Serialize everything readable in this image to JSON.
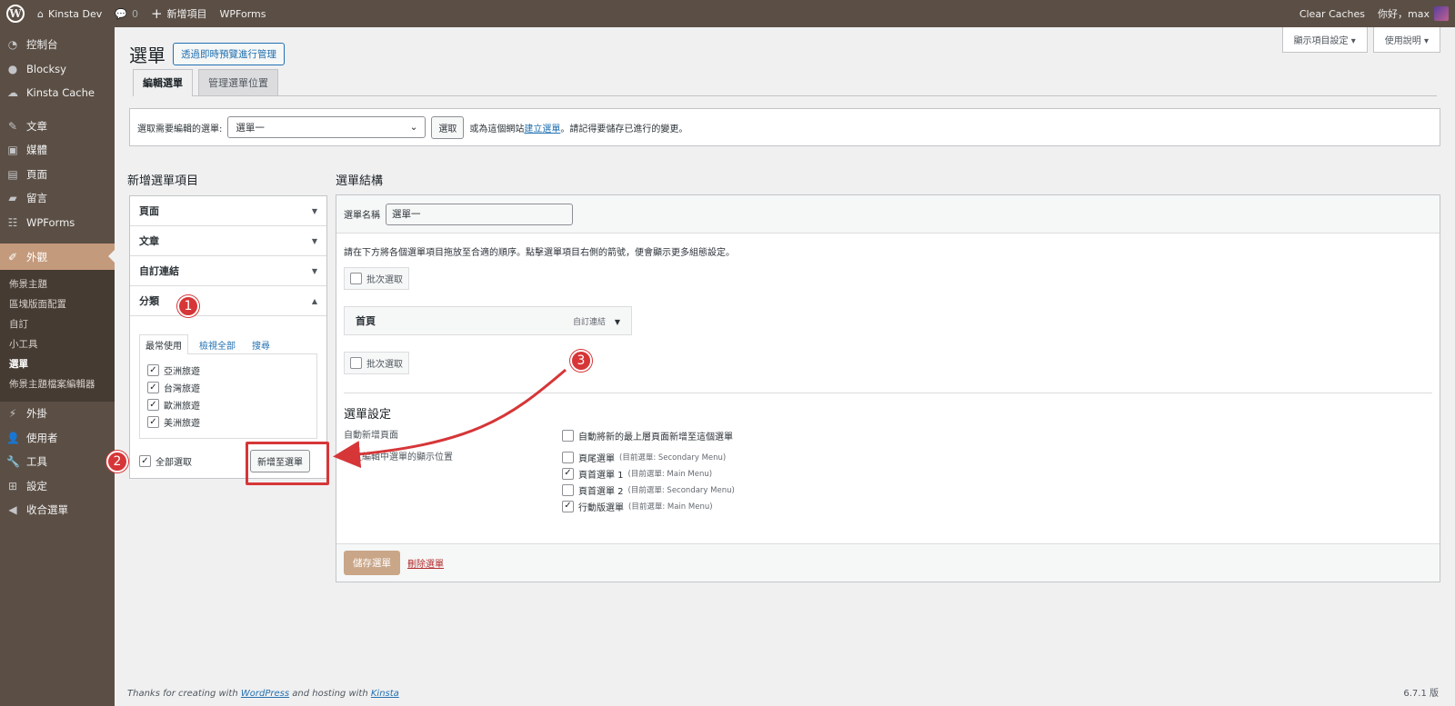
{
  "adminbar": {
    "site_name": "Kinsta Dev",
    "comments_count": "0",
    "new_label": "新增項目",
    "wpforms": "WPForms",
    "clear_caches": "Clear Caches",
    "greeting": "你好，max"
  },
  "sidebar": {
    "items": [
      {
        "label": "控制台",
        "icon": "dashboard-icon"
      },
      {
        "label": "Blocksy",
        "icon": "blocksy-icon"
      },
      {
        "label": "Kinsta Cache",
        "icon": "cloud-icon"
      },
      {
        "label": "文章",
        "icon": "pin-icon"
      },
      {
        "label": "媒體",
        "icon": "media-icon"
      },
      {
        "label": "頁面",
        "icon": "page-icon"
      },
      {
        "label": "留言",
        "icon": "comment-icon"
      },
      {
        "label": "WPForms",
        "icon": "forms-icon"
      },
      {
        "label": "外觀",
        "icon": "brush-icon"
      },
      {
        "label": "外掛",
        "icon": "plugin-icon"
      },
      {
        "label": "使用者",
        "icon": "user-icon"
      },
      {
        "label": "工具",
        "icon": "wrench-icon"
      },
      {
        "label": "設定",
        "icon": "settings-icon"
      },
      {
        "label": "收合選單",
        "icon": "collapse-icon"
      }
    ],
    "submenu": [
      "佈景主題",
      "區塊版面配置",
      "自訂",
      "小工具",
      "選單",
      "佈景主題檔案編輯器"
    ]
  },
  "header": {
    "screen_options": "顯示項目設定",
    "help": "使用說明",
    "title": "選單",
    "live_preview": "透過即時預覽進行管理",
    "tabs": [
      "編輯選單",
      "管理選單位置"
    ]
  },
  "select_bar": {
    "label": "選取需要編輯的選單:",
    "selected": "選單一",
    "select_btn": "選取",
    "or_text": "或為這個網站",
    "create_link": "建立選單",
    "remember": "。請記得要儲存已進行的變更。"
  },
  "add_items": {
    "title": "新增選單項目",
    "sections": [
      "頁面",
      "文章",
      "自訂連結",
      "分類"
    ],
    "subtabs": [
      "最常使用",
      "檢視全部",
      "搜尋"
    ],
    "categories": [
      {
        "label": "亞洲旅遊",
        "checked": true
      },
      {
        "label": "台灣旅遊",
        "checked": true
      },
      {
        "label": "歐洲旅遊",
        "checked": true
      },
      {
        "label": "美洲旅遊",
        "checked": true
      }
    ],
    "select_all": "全部選取",
    "add_button": "新增至選單"
  },
  "structure": {
    "title": "選單結構",
    "name_label": "選單名稱",
    "name_value": "選單一",
    "instructions": "請在下方將各個選單項目拖放至合適的順序。點擊選單項目右側的箭號，便會顯示更多組態設定。",
    "bulk_select": "批次選取",
    "menu_item": {
      "title": "首頁",
      "type": "自訂連結"
    },
    "settings_title": "選單設定",
    "auto_add_label": "自動新增頁面",
    "auto_add_option": "自動將新的最上層頁面新增至這個選單",
    "display_label": "指定編輯中選單的顯示位置",
    "locations": [
      {
        "label": "頁尾選單",
        "note": "(目前選單: Secondary Menu)",
        "checked": false
      },
      {
        "label": "頁首選單 1",
        "note": "(目前選單: Main Menu)",
        "checked": true
      },
      {
        "label": "頁首選單 2",
        "note": "(目前選單: Secondary Menu)",
        "checked": false
      },
      {
        "label": "行動版選單",
        "note": "(目前選單: Main Menu)",
        "checked": true
      }
    ],
    "save": "儲存選單",
    "delete": "刪除選單"
  },
  "annotations": [
    "1",
    "2",
    "3"
  ],
  "footer": {
    "text_a": "Thanks for creating with ",
    "wp": "WordPress",
    "text_b": " and hosting with ",
    "kinsta": "Kinsta",
    "version": "6.7.1 版"
  },
  "colors": {
    "accent": "#c49a7c",
    "annotation": "#d63638",
    "admin_bar": "#5b4f45"
  }
}
